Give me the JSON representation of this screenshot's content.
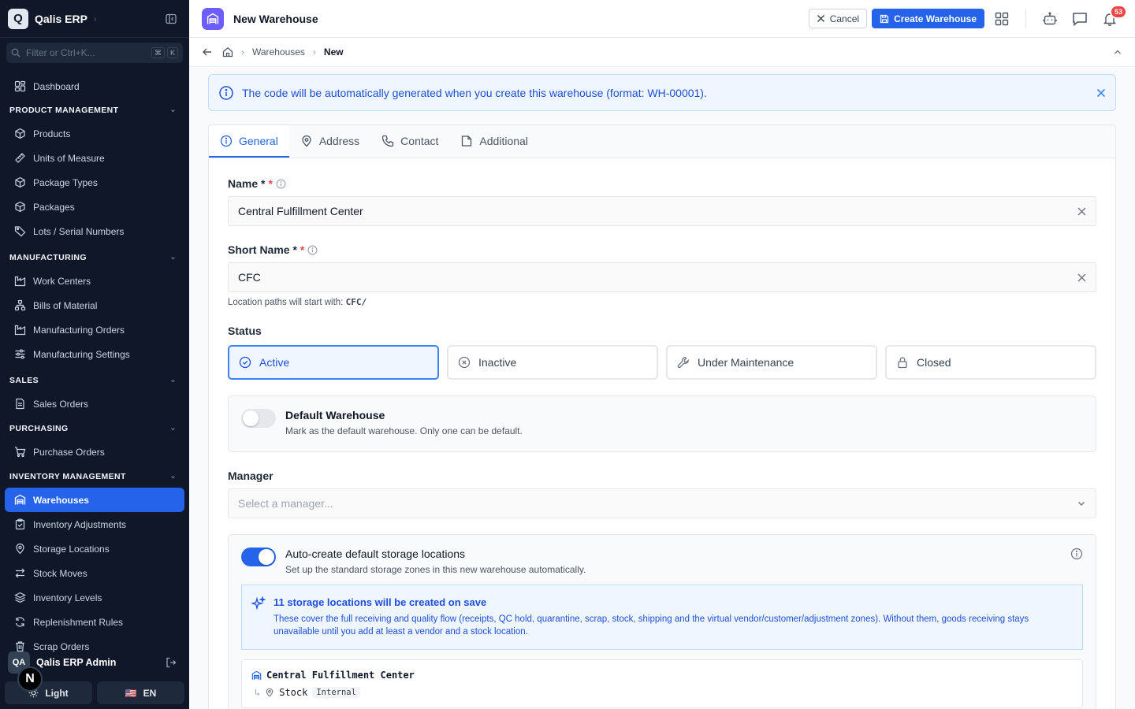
{
  "app": {
    "logo_letter": "Q",
    "name": "Qalis ERP"
  },
  "search": {
    "placeholder": "Filter or Ctrl+K...",
    "kbd1": "⌘",
    "kbd2": "K"
  },
  "nav": {
    "dashboard": "Dashboard",
    "sections": {
      "product": "PRODUCT MANAGEMENT",
      "manufacturing": "MANUFACTURING",
      "sales": "SALES",
      "purchasing": "PURCHASING",
      "inventory": "INVENTORY MANAGEMENT"
    },
    "product_items": [
      "Products",
      "Units of Measure",
      "Package Types",
      "Packages",
      "Lots / Serial Numbers"
    ],
    "manufacturing_items": [
      "Work Centers",
      "Bills of Material",
      "Manufacturing Orders",
      "Manufacturing Settings"
    ],
    "sales_items": [
      "Sales Orders"
    ],
    "purchasing_items": [
      "Purchase Orders"
    ],
    "inventory_items": [
      "Warehouses",
      "Inventory Adjustments",
      "Storage Locations",
      "Stock Moves",
      "Inventory Levels",
      "Replenishment Rules",
      "Scrap Orders"
    ]
  },
  "user": {
    "initials": "QA",
    "name": "Qalis ERP Admin"
  },
  "footer": {
    "theme": "Light",
    "lang": "EN",
    "flag": "🇺🇸",
    "n_badge": "N"
  },
  "header": {
    "title": "New Warehouse",
    "cancel": "Cancel",
    "create": "Create Warehouse",
    "notifications": "53"
  },
  "breadcrumb": {
    "parent": "Warehouses",
    "current": "New"
  },
  "banner": {
    "text": "The code will be automatically generated when you create this warehouse (format: WH-00001)."
  },
  "tabs": [
    "General",
    "Address",
    "Contact",
    "Additional"
  ],
  "form": {
    "name_label": "Name *",
    "name_value": "Central Fulfillment Center",
    "short_label": "Short Name *",
    "short_value": "CFC",
    "path_hint": "Location paths will start with:",
    "path_code": "CFC/",
    "status_label": "Status",
    "status_options": [
      "Active",
      "Inactive",
      "Under Maintenance",
      "Closed"
    ],
    "default_title": "Default Warehouse",
    "default_sub": "Mark as the default warehouse. Only one can be default.",
    "manager_label": "Manager",
    "manager_placeholder": "Select a manager...",
    "auto_title": "Auto-create default storage locations",
    "auto_sub": "Set up the standard storage zones in this new warehouse automatically.",
    "notice_title": "11 storage locations will be created on save",
    "notice_body": "These cover the full receiving and quality flow (receipts, QC hold, quarantine, scrap, stock, shipping and the virtual vendor/customer/adjustment zones). Without them, goods receiving stays unavailable until you add at least a vendor and a stock location.",
    "tree_root": "Central Fulfillment Center",
    "tree_child": "Stock",
    "tree_child_tag": "Internal"
  }
}
